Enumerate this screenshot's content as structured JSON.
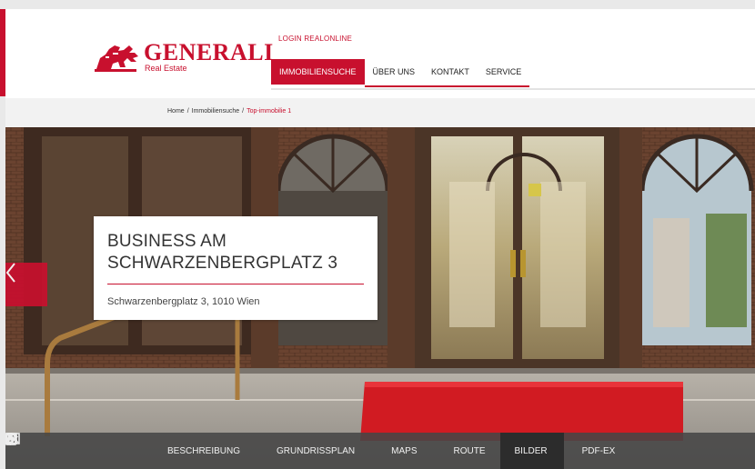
{
  "brand": {
    "name": "GENERALI",
    "sub": "Real Estate"
  },
  "header": {
    "login_label": "LOGIN REALONLINE",
    "nav": [
      {
        "label": "IMMOBILIENSUCHE",
        "active": true
      },
      {
        "label": "ÜBER UNS",
        "active": false
      },
      {
        "label": "KONTAKT",
        "active": false
      },
      {
        "label": "SERVICE",
        "active": false
      }
    ]
  },
  "breadcrumb": {
    "items": [
      "Home",
      "Immobiliensuche",
      "Top-immobilie 1"
    ],
    "separator": "/"
  },
  "hero": {
    "title": "BUSINESS AM SCHWARZENBERGPLATZ 3",
    "address": "Schwarzenbergplatz 3, 1010 Wien"
  },
  "tabs": [
    {
      "label": "BESCHREIBUNG",
      "icon": "document-icon"
    },
    {
      "label": "GRUNDRISSPLAN",
      "icon": "floorplan-icon"
    },
    {
      "label": "MAPS",
      "icon": "map-pin-icon"
    },
    {
      "label": "ROUTE",
      "icon": "signpost-icon"
    },
    {
      "label": "BILDER",
      "icon": "image-icon",
      "active": true
    },
    {
      "label": "PDF-EX",
      "icon": "pdf-icon"
    }
  ],
  "colors": {
    "brand_red": "#c8102e",
    "tabbar": "#464646",
    "tab_active": "#2c2c2c"
  }
}
